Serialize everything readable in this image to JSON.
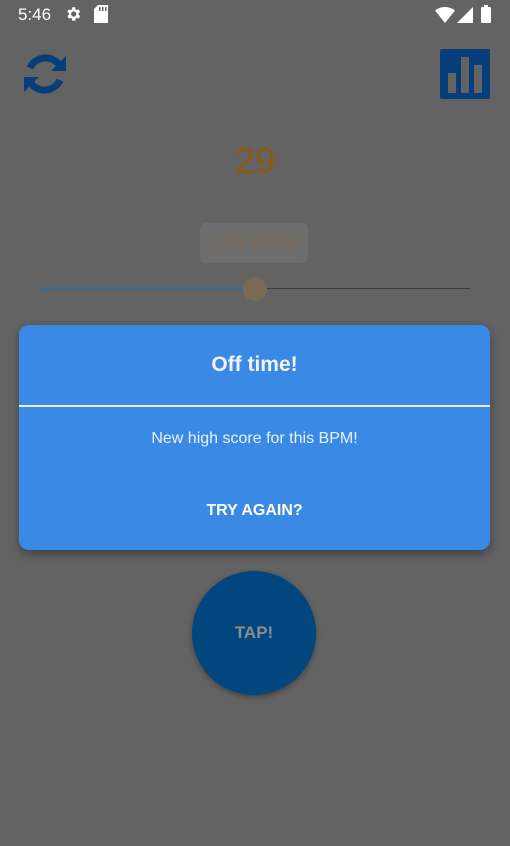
{
  "status_bar": {
    "time": "5:46",
    "icons": [
      "gear-icon",
      "sd-card-icon",
      "wifi-icon",
      "cell-signal-icon",
      "battery-icon"
    ]
  },
  "app_bar": {
    "left_icon": "refresh-icon",
    "right_icon": "bar-chart-icon",
    "icon_color": "#063e7a"
  },
  "game": {
    "score": "29",
    "bpm_label": "105 BPM",
    "bpm_slider_fraction": 0.5,
    "tap_label": "TAP!"
  },
  "dialog": {
    "title": "Off time!",
    "message": "New high score for this BPM!",
    "button_label": "TRY AGAIN?",
    "background": "#3a8ae5"
  },
  "colors": {
    "scrim": "#636363",
    "score": "#8a5a14",
    "tap_button": "#02467f"
  }
}
